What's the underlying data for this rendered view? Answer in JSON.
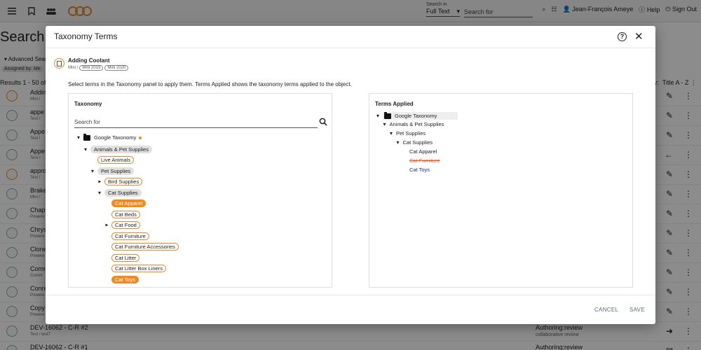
{
  "app": {
    "search_in_label": "Search in",
    "search_in_value": "Full Text",
    "search_placeholder": "Search for",
    "user_name": "Jean-François Ameye",
    "help_label": "Help",
    "signout_label": "Sign Out",
    "page_title": "Search",
    "advanced_label": "Advanced Searc",
    "assigned_label": "Assigned by: Me",
    "results_text": "Results 1 - 50 of 2",
    "sort_label": "by:",
    "sort_value": "Title A - Z"
  },
  "background_rows": [
    {
      "title": "Addin",
      "sub": "Mini /"
    },
    {
      "title": "appe",
      "sub": "Test /"
    },
    {
      "title": "Appe",
      "sub": "Test /"
    },
    {
      "title": "Appe",
      "sub": "Test /"
    },
    {
      "title": "appro",
      "sub": "Test /"
    },
    {
      "title": "Brake",
      "sub": "Mini /"
    },
    {
      "title": "Chapt",
      "sub": "Powere"
    },
    {
      "title": "Chrys",
      "sub": "Powere"
    },
    {
      "title": "Clone",
      "sub": "Powere"
    },
    {
      "title": "Comm",
      "sub": "Comm"
    },
    {
      "title": "Conre",
      "sub": "Powere"
    },
    {
      "title": "Copy",
      "sub": "Powere"
    },
    {
      "title": "DEV-16062 - C-R #2",
      "sub": "Test / test7",
      "wf": "Authoring:review",
      "wfs": "collaborative review"
    },
    {
      "title": "DEV-16062 - C-R #1",
      "sub": "",
      "wf": "Authoring:review",
      "wfs": ""
    }
  ],
  "modal": {
    "title": "Taxonomy Terms",
    "object_name": "Adding Coolant",
    "object_path": "Mini /",
    "object_tags": [
      "Mini 2019",
      "Mini 2020"
    ],
    "instructions": "Select terms in the Taxonomy panel to apply them. Terms Applied shows the taxonomy terms applied to the object.",
    "taxonomy_title": "Taxonomy",
    "taxonomy_search_placeholder": "Search for",
    "applied_title": "Terms Applied",
    "cancel_label": "CANCEL",
    "save_label": "SAVE"
  },
  "taxonomy_tree": [
    {
      "label": "Google Taxonomy",
      "level": 0,
      "expanded": true,
      "folder": true,
      "style": "plain",
      "dot": true
    },
    {
      "label": "Animals & Pet Supplies",
      "level": 1,
      "expanded": true,
      "style": "gray"
    },
    {
      "label": "Live Animals",
      "level": 2,
      "style": "outline"
    },
    {
      "label": "Pet Supplies",
      "level": 2,
      "expanded": true,
      "style": "gray"
    },
    {
      "label": "Bird Supplies",
      "level": 3,
      "expanded": false,
      "style": "outline"
    },
    {
      "label": "Cat Supplies",
      "level": 3,
      "expanded": true,
      "style": "gray"
    },
    {
      "label": "Cat Apparel",
      "level": 4,
      "style": "filled"
    },
    {
      "label": "Cat Beds",
      "level": 4,
      "style": "outline"
    },
    {
      "label": "Cat Food",
      "level": 4,
      "expanded": false,
      "style": "outline"
    },
    {
      "label": "Cat Furniture",
      "level": 4,
      "style": "outline"
    },
    {
      "label": "Cat Furniture Accessories",
      "level": 4,
      "style": "outline"
    },
    {
      "label": "Cat Litter",
      "level": 4,
      "style": "outline"
    },
    {
      "label": "Cat Litter Box Liners",
      "level": 4,
      "style": "outline"
    },
    {
      "label": "Cat Toys",
      "level": 4,
      "style": "filled"
    }
  ],
  "applied_tree": [
    {
      "label": "Google Taxonomy",
      "level": 0,
      "state": "normal"
    },
    {
      "label": "Animals & Pet Supplies",
      "level": 1,
      "state": "normal"
    },
    {
      "label": "Pet Supplies",
      "level": 2,
      "state": "normal"
    },
    {
      "label": "Cat Supplies",
      "level": 3,
      "state": "normal"
    },
    {
      "label": "Cat Apparel",
      "level": 4,
      "state": "normal"
    },
    {
      "label": "Cat Furniture",
      "level": 4,
      "state": "removed"
    },
    {
      "label": "Cat Toys",
      "level": 4,
      "state": "added"
    }
  ],
  "colors": {
    "accent_orange": "#f18a1e",
    "removed": "#e8541e",
    "added": "#1f2aa8",
    "button_text": "#5a6b8a"
  }
}
